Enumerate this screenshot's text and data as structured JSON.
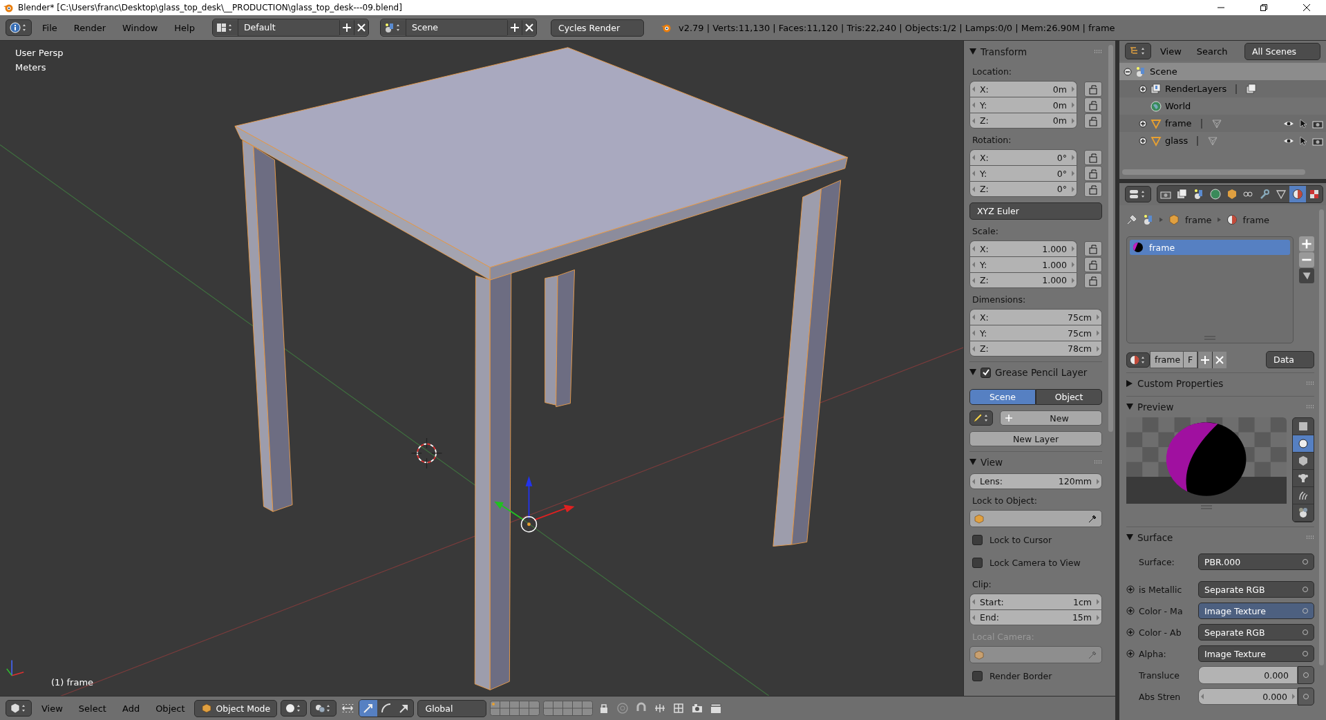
{
  "window": {
    "title": "Blender* [C:\\Users\\franc\\Desktop\\glass_top_desk\\__PRODUCTION\\glass_top_desk---09.blend]"
  },
  "top_header": {
    "menus": [
      "File",
      "Render",
      "Window",
      "Help"
    ],
    "screen_layout": "Default",
    "scene": "Scene",
    "render_engine": "Cycles Render",
    "stats": "v2.79 | Verts:11,130 | Faces:11,120 | Tris:22,240 | Objects:1/2 | Lamps:0/0 | Mem:26.90M | frame"
  },
  "viewport": {
    "view_label": "User Persp",
    "units_label": "Meters",
    "object_label": "(1) frame"
  },
  "transform_panel": {
    "title": "Transform",
    "expanded": true,
    "groups": [
      {
        "label": "Location:",
        "lockable": true,
        "fields": [
          {
            "axis": "X:",
            "value": "0m"
          },
          {
            "axis": "Y:",
            "value": "0m"
          },
          {
            "axis": "Z:",
            "value": "0m"
          }
        ]
      },
      {
        "label": "Rotation:",
        "lockable": true,
        "fields": [
          {
            "axis": "X:",
            "value": "0°"
          },
          {
            "axis": "Y:",
            "value": "0°"
          },
          {
            "axis": "Z:",
            "value": "0°"
          }
        ],
        "mode": "XYZ Euler"
      },
      {
        "label": "Scale:",
        "lockable": true,
        "fields": [
          {
            "axis": "X:",
            "value": "1.000"
          },
          {
            "axis": "Y:",
            "value": "1.000"
          },
          {
            "axis": "Z:",
            "value": "1.000"
          }
        ]
      },
      {
        "label": "Dimensions:",
        "lockable": false,
        "fields": [
          {
            "axis": "X:",
            "value": "75cm"
          },
          {
            "axis": "Y:",
            "value": "75cm"
          },
          {
            "axis": "Z:",
            "value": "78cm"
          }
        ]
      }
    ]
  },
  "grease_pencil_panel": {
    "title": "Grease Pencil Layer",
    "expanded": true,
    "enabled": true,
    "tabs": [
      {
        "label": "Scene",
        "selected": true
      },
      {
        "label": "Object",
        "selected": false
      }
    ],
    "new_button": "New",
    "new_layer_button": "New Layer"
  },
  "view_panel": {
    "title": "View",
    "expanded": true,
    "lens": {
      "label": "Lens:",
      "value": "120mm"
    },
    "lock_object_label": "Lock to Object:",
    "lock_options": [
      {
        "label": "Lock to Cursor",
        "checked": false
      },
      {
        "label": "Lock Camera to View",
        "checked": false
      }
    ],
    "clip_label": "Clip:",
    "clip": [
      {
        "label": "Start:",
        "value": "1cm"
      },
      {
        "label": "End:",
        "value": "15m"
      }
    ],
    "local_camera_label": "Local Camera:",
    "local_camera_disabled": true,
    "render_border": {
      "label": "Render Border",
      "checked": false
    }
  },
  "outliner": {
    "menus": [
      "View",
      "Search"
    ],
    "display_mode": "All Scenes",
    "tree": [
      {
        "label": "Scene",
        "kind": "scene",
        "expanded": true,
        "selected": true,
        "children": [
          {
            "label": "RenderLayers",
            "kind": "render_layers",
            "expanded": false,
            "selected": false
          },
          {
            "label": "World",
            "kind": "world",
            "selected": false
          },
          {
            "label": "frame",
            "kind": "mesh_object",
            "expanded": false,
            "selected": false
          },
          {
            "label": "glass",
            "kind": "mesh_object",
            "expanded": false,
            "selected": false
          }
        ]
      }
    ]
  },
  "properties": {
    "tabs": [
      {
        "kind": "render",
        "selected": false
      },
      {
        "kind": "render_layers",
        "selected": false
      },
      {
        "kind": "scene",
        "selected": false
      },
      {
        "kind": "world",
        "selected": false
      },
      {
        "kind": "object",
        "selected": false
      },
      {
        "kind": "constraints",
        "selected": false
      },
      {
        "kind": "modifiers",
        "selected": false
      },
      {
        "kind": "data",
        "selected": false
      },
      {
        "kind": "material",
        "selected": true
      },
      {
        "kind": "texture",
        "selected": false
      }
    ],
    "breadcrumb": [
      "frame",
      "frame"
    ],
    "material_slots": [
      {
        "name": "frame",
        "selected": true
      }
    ],
    "material_selector": {
      "name": "frame",
      "fake_user": "F",
      "link": "Data"
    },
    "custom_properties": {
      "title": "Custom Properties",
      "expanded": false
    },
    "preview": {
      "title": "Preview",
      "expanded": true,
      "shapes": [
        {
          "kind": "plane",
          "selected": false
        },
        {
          "kind": "sphere",
          "selected": true
        },
        {
          "kind": "cube",
          "selected": false
        },
        {
          "kind": "monkey",
          "selected": false
        },
        {
          "kind": "hair",
          "selected": false
        },
        {
          "kind": "sky_sphere",
          "selected": false
        }
      ]
    },
    "surface": {
      "title": "Surface",
      "expanded": true,
      "surface_label": "Surface:",
      "surface_value": "PBR.000",
      "inputs": [
        {
          "label": "is Metallic",
          "kind": "link",
          "value": "Separate RGB",
          "selected": false
        },
        {
          "label": "Color - Ma",
          "kind": "link",
          "value": "Image Texture",
          "selected": true
        },
        {
          "label": "Color - Ab",
          "kind": "link",
          "value": "Separate RGB",
          "selected": false
        },
        {
          "label": "Alpha:",
          "kind": "link",
          "value": "Image Texture",
          "selected": false
        },
        {
          "label": "Transluce",
          "kind": "slider",
          "value": "0.000",
          "level": 0
        },
        {
          "label": "Abs Stren",
          "kind": "number",
          "value": "0.000"
        }
      ]
    }
  },
  "bottom_header": {
    "menus": [
      "View",
      "Select",
      "Add",
      "Object"
    ],
    "mode": "Object Mode",
    "orientation": "Global",
    "manipulators": [
      {
        "kind": "translate",
        "selected": true
      },
      {
        "kind": "rotate",
        "selected": false
      },
      {
        "kind": "scale",
        "selected": false
      }
    ]
  }
}
